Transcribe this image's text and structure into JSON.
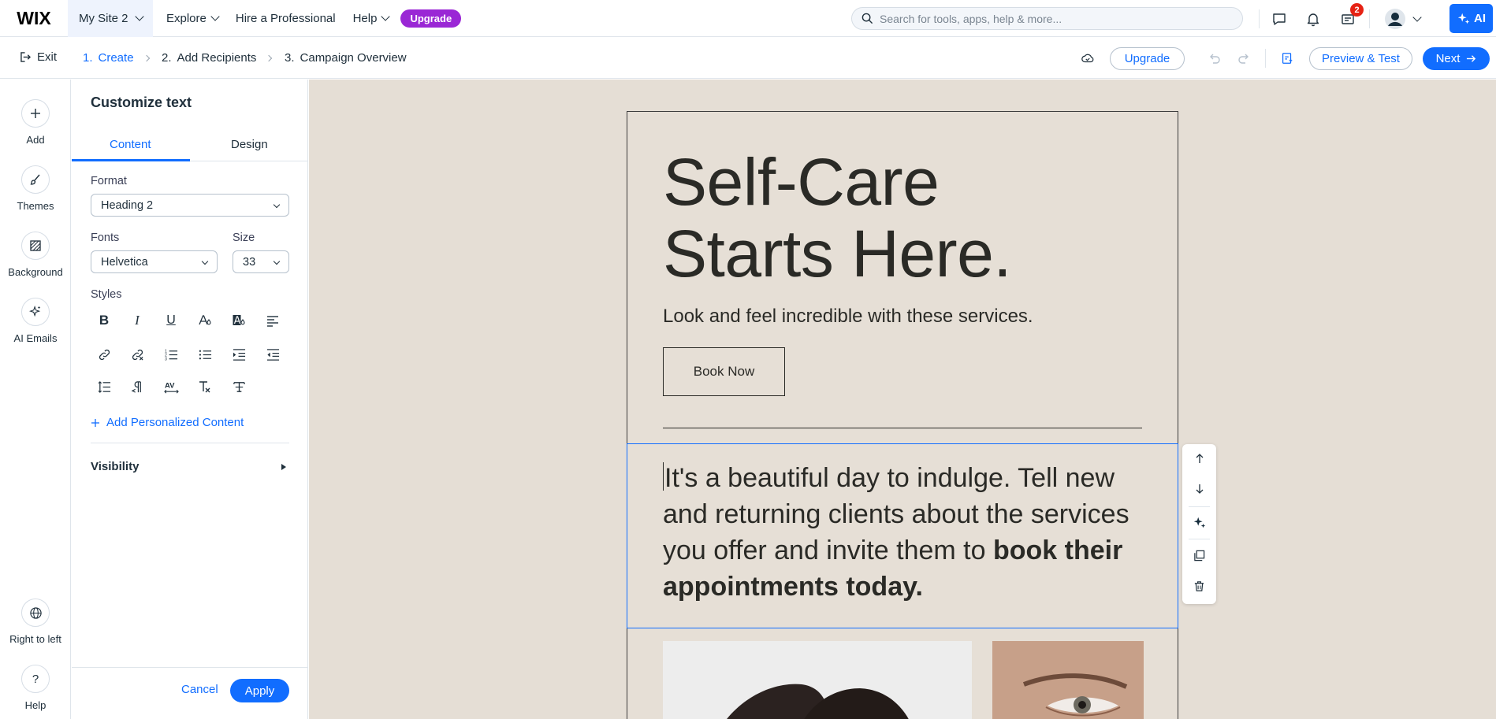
{
  "topbar": {
    "logo": "WIX",
    "site_name": "My Site 2",
    "menu": {
      "explore": "Explore",
      "hire": "Hire a Professional",
      "help": "Help"
    },
    "upgrade_label": "Upgrade",
    "search_placeholder": "Search for tools, apps, help & more...",
    "notifications_badge": "2",
    "ai_label": "AI"
  },
  "subbar": {
    "exit_label": "Exit",
    "steps": [
      {
        "number": "1.",
        "label": "Create"
      },
      {
        "number": "2.",
        "label": "Add Recipients"
      },
      {
        "number": "3.",
        "label": "Campaign Overview"
      }
    ],
    "upgrade_label": "Upgrade",
    "preview_label": "Preview & Test",
    "next_label": "Next"
  },
  "rail": {
    "add": "Add",
    "themes": "Themes",
    "background": "Background",
    "ai_emails": "AI Emails",
    "rtl": "Right to left",
    "help": "Help"
  },
  "panel": {
    "title": "Customize text",
    "tabs": {
      "content": "Content",
      "design": "Design"
    },
    "format_label": "Format",
    "format_value": "Heading 2",
    "fonts_label": "Fonts",
    "font_value": "Helvetica",
    "size_label": "Size",
    "size_value": "33",
    "styles_label": "Styles",
    "add_personalized": "Add Personalized Content",
    "visibility": "Visibility",
    "cancel": "Cancel",
    "apply": "Apply"
  },
  "email": {
    "headline_line1": "Self-Care",
    "headline_line2": "Starts Here.",
    "subhead": "Look and feel incredible with these services.",
    "button": "Book Now",
    "body_regular": "It's a beautiful day to indulge. Tell new and returning clients about the services you offer and invite them to ",
    "body_bold": "book their appointments today."
  },
  "colors": {
    "accent": "#116dff",
    "upgrade": "#9a27d5",
    "canvas_bg": "#e5ded5",
    "badge": "#e62214"
  }
}
